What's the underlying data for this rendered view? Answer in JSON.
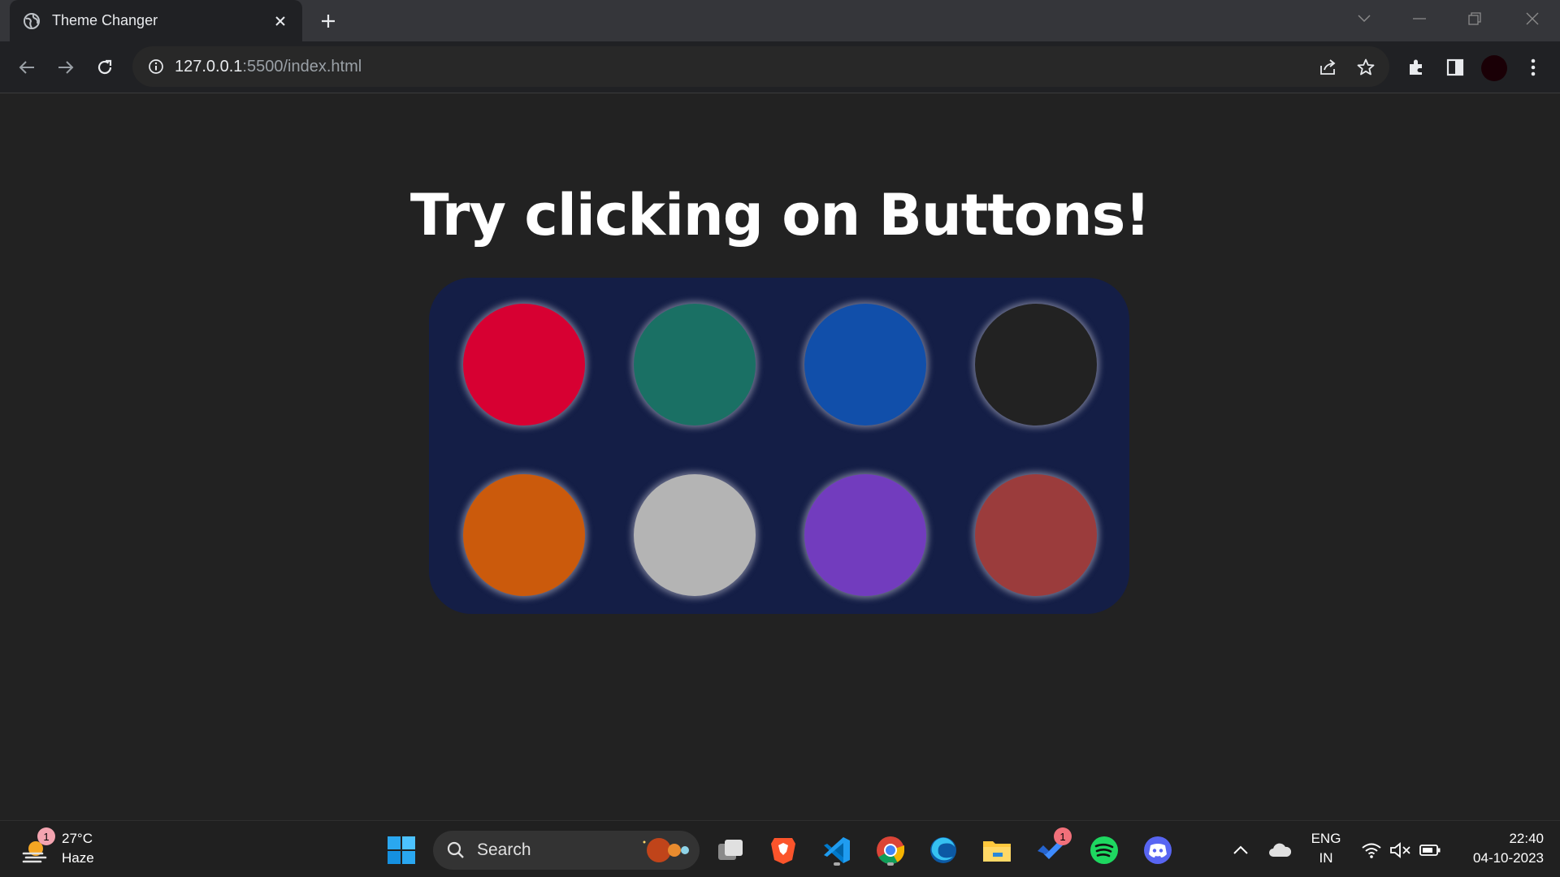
{
  "browser": {
    "tab_title": "Theme Changer",
    "url_host": "127.0.0.1",
    "url_rest": ":5500/index.html"
  },
  "page": {
    "heading": "Try clicking on Buttons!",
    "palette_bg": "#141e46",
    "swatches": [
      {
        "name": "red",
        "color": "#d70032"
      },
      {
        "name": "teal",
        "color": "#1a7064"
      },
      {
        "name": "blue",
        "color": "#114faa"
      },
      {
        "name": "black",
        "color": "#222222"
      },
      {
        "name": "orange",
        "color": "#cb5a0c"
      },
      {
        "name": "silver",
        "color": "#b4b4b4"
      },
      {
        "name": "purple",
        "color": "#723cbe"
      },
      {
        "name": "brown",
        "color": "#9b3c3c"
      }
    ]
  },
  "taskbar": {
    "weather_temp": "27°C",
    "weather_condition": "Haze",
    "weather_badge": "1",
    "search_label": "Search",
    "todo_badge": "1",
    "lang_line1": "ENG",
    "lang_line2": "IN",
    "time": "22:40",
    "date": "04-10-2023"
  }
}
